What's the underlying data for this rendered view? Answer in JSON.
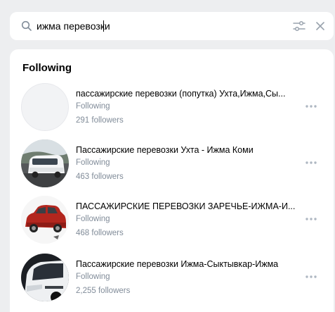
{
  "search": {
    "value": "ижма перевозки",
    "icon": "search-icon",
    "filter_icon": "filter-sliders-icon",
    "clear_icon": "close-icon"
  },
  "section": {
    "title": "Following"
  },
  "results": [
    {
      "name": "пассажирские перевозки (попутка) Ухта,Ижма,Сы...",
      "status": "Following",
      "followers": "291 followers",
      "avatar": "blank"
    },
    {
      "name": "Пассажирские перевозки Ухта - Ижма Коми",
      "status": "Following",
      "followers": "463 followers",
      "avatar": "white-van"
    },
    {
      "name": "ПАССАЖИРСКИЕ ПЕРЕВОЗКИ ЗАРЕЧЬЕ-ИЖМА-И...",
      "status": "Following",
      "followers": "468 followers",
      "avatar": "red-car"
    },
    {
      "name": "Пассажирские перевозки Ижма-Сыктывкар-Ижма",
      "status": "Following",
      "followers": "2,255 followers",
      "avatar": "white-minibus"
    }
  ],
  "colors": {
    "background": "#edeef0",
    "panel": "#ffffff",
    "secondary_text": "#818c99",
    "icon": "#99a2ad"
  }
}
